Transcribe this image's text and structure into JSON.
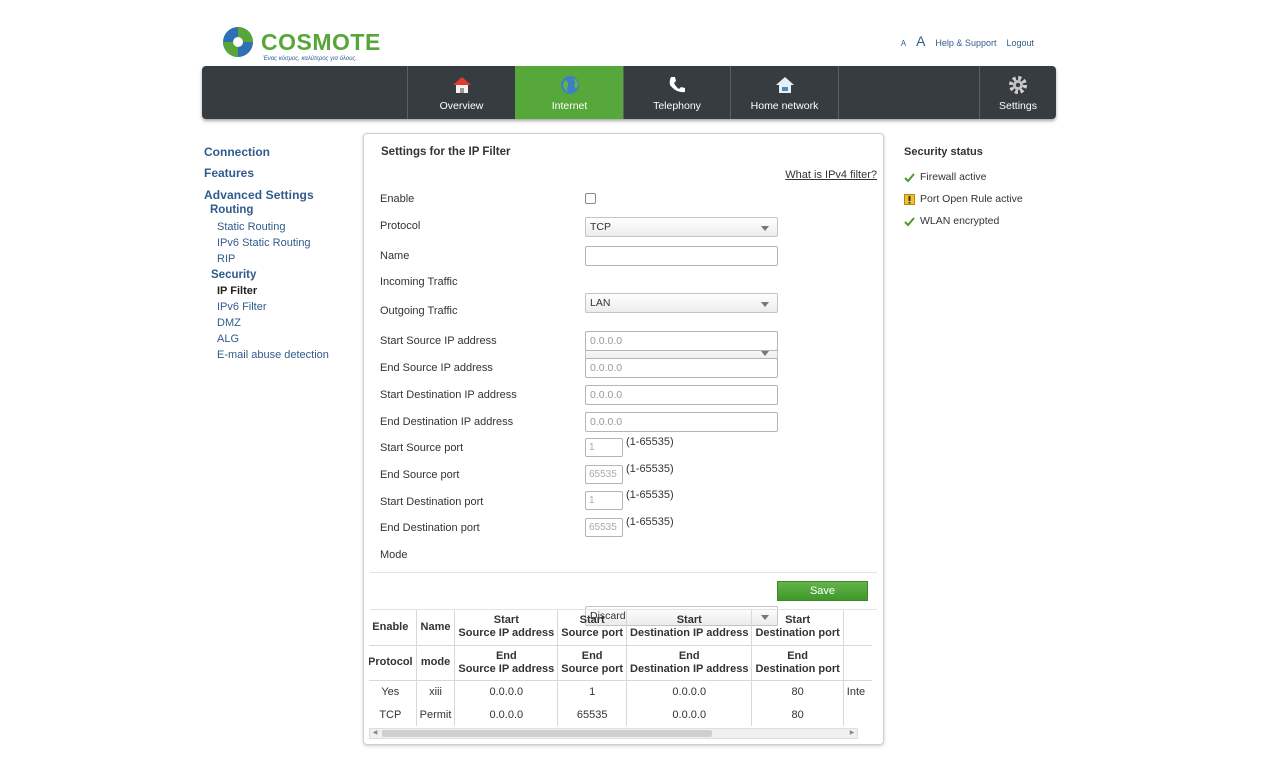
{
  "brand": {
    "name": "COSMOTE",
    "tagline": "Ένας κόσμος, καλύτερος για όλους."
  },
  "top_links": {
    "font_small": "A",
    "font_big": "A",
    "help": "Help & Support",
    "logout": "Logout"
  },
  "nav": [
    {
      "id": "overview",
      "label": "Overview",
      "icon": "house-icon",
      "active": false
    },
    {
      "id": "internet",
      "label": "Internet",
      "icon": "globe-icon",
      "active": true
    },
    {
      "id": "telephony",
      "label": "Telephony",
      "icon": "phone-icon",
      "active": false
    },
    {
      "id": "home-network",
      "label": "Home network",
      "icon": "home-network-icon",
      "active": false
    },
    {
      "id": "settings",
      "label": "Settings",
      "icon": "gear-icon",
      "active": false
    }
  ],
  "sidebar": {
    "connection": "Connection",
    "features": "Features",
    "advanced": "Advanced Settings",
    "routing": "Routing",
    "static_routing": "Static Routing",
    "ipv6_static_routing": "IPv6 Static Routing",
    "rip": "RIP",
    "security": "Security",
    "ip_filter": "IP Filter",
    "ipv6_filter": "IPv6 Filter",
    "dmz": "DMZ",
    "alg": "ALG",
    "email_abuse": "E-mail abuse detection"
  },
  "panel": {
    "title": "Settings for the IP Filter",
    "help_link": "What is IPv4 filter?",
    "fields": {
      "enable": {
        "label": "Enable",
        "checked": false
      },
      "protocol": {
        "label": "Protocol",
        "value": "TCP"
      },
      "name": {
        "label": "Name",
        "value": ""
      },
      "incoming": {
        "label": "Incoming Traffic",
        "value": "LAN"
      },
      "outgoing": {
        "label": "Outgoing Traffic",
        "value": ""
      },
      "start_src_ip": {
        "label": "Start Source IP address",
        "placeholder": "0.0.0.0"
      },
      "end_src_ip": {
        "label": "End Source IP address",
        "placeholder": "0.0.0.0"
      },
      "start_dst_ip": {
        "label": "Start Destination IP address",
        "placeholder": "0.0.0.0"
      },
      "end_dst_ip": {
        "label": "End Destination IP address",
        "placeholder": "0.0.0.0"
      },
      "start_src_port": {
        "label": "Start Source port",
        "placeholder": "1",
        "range": "(1-65535)"
      },
      "end_src_port": {
        "label": "End Source port",
        "placeholder": "65535",
        "range": "(1-65535)"
      },
      "start_dst_port": {
        "label": "Start Destination port",
        "placeholder": "1",
        "range": "(1-65535)"
      },
      "end_dst_port": {
        "label": "End Destination port",
        "placeholder": "65535",
        "range": "(1-65535)"
      },
      "mode": {
        "label": "Mode",
        "value": "Discard"
      }
    },
    "save_label": "Save"
  },
  "table": {
    "header_row1": [
      "Enable",
      "Name",
      "Start\nSource IP address",
      "Start\nSource port",
      "Start\nDestination IP address",
      "Start\nDestination port",
      ""
    ],
    "header_row2": [
      "Protocol",
      "mode",
      "End\nSource IP address",
      "End\nSource port",
      "End\nDestination IP address",
      "End\nDestination port",
      ""
    ],
    "rows": [
      [
        "Yes",
        "xiii",
        "0.0.0.0",
        "1",
        "0.0.0.0",
        "80",
        "Inte"
      ],
      [
        "TCP",
        "Permit",
        "0.0.0.0",
        "65535",
        "0.0.0.0",
        "80",
        ""
      ]
    ]
  },
  "security_status": {
    "title": "Security status",
    "items": [
      {
        "label": "Firewall active",
        "state": "ok",
        "icon": "check-icon"
      },
      {
        "label": "Port Open Rule active",
        "state": "warning",
        "icon": "warning-icon"
      },
      {
        "label": "WLAN encrypted",
        "state": "ok",
        "icon": "check-icon"
      }
    ]
  },
  "colors": {
    "brand_green": "#57a83b",
    "nav_bg": "#373c41",
    "link_blue": "#315b8c"
  }
}
